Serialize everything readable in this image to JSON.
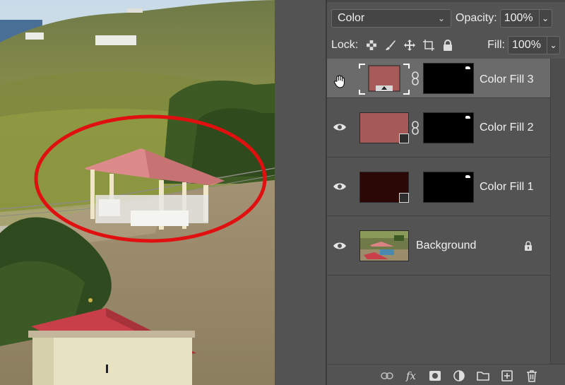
{
  "options": {
    "blend_mode": "Color",
    "opacity_label": "Opacity:",
    "opacity_value": "100%",
    "lock_label": "Lock:",
    "fill_label": "Fill:",
    "fill_value": "100%"
  },
  "layers": [
    {
      "name": "Color Fill 3",
      "thumb_color": "#a85a58",
      "selected": true
    },
    {
      "name": "Color Fill 2",
      "thumb_color": "#a55a58",
      "selected": false
    },
    {
      "name": "Color Fill 1",
      "thumb_color": "#2b0806",
      "selected": false
    },
    {
      "name": "Background",
      "locked": true,
      "selected": false
    }
  ],
  "footer": {
    "fx_label": "fx",
    "icons": [
      "link-layers-icon",
      "fx-icon",
      "add-mask-icon",
      "adjustment-layer-icon",
      "new-group-icon",
      "new-layer-icon",
      "trash-icon"
    ]
  },
  "colors": {
    "panel_bg": "#535353",
    "selected_row": "#6b6b6b",
    "annotation_circle": "#e01010",
    "roof_pink": "#d98384",
    "roof_red": "#c0404a"
  }
}
